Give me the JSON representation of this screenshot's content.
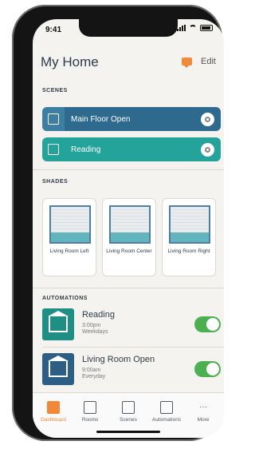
{
  "status": {
    "time": "9:41"
  },
  "header": {
    "title": "My Home",
    "edit": "Edit"
  },
  "scenes": {
    "label": "SCENES",
    "items": [
      {
        "label": "Main Floor Open",
        "color": "#2d6a8e",
        "icon": "window-icon"
      },
      {
        "label": "Reading",
        "color": "#24a39b",
        "icon": "book-icon"
      }
    ]
  },
  "shades": {
    "label": "SHADES",
    "items": [
      {
        "name": "Living Room Left"
      },
      {
        "name": "Living Room Center"
      },
      {
        "name": "Living Room Right"
      }
    ]
  },
  "automations": {
    "label": "AUTOMATIONS",
    "items": [
      {
        "name": "Reading",
        "time": "3:00pm",
        "days": "Weekdays",
        "tile_color": "#1f8f86",
        "enabled": true
      },
      {
        "name": "Living Room Open",
        "time": "9:00am",
        "days": "Everyday",
        "tile_color": "#2d5f86",
        "enabled": true
      }
    ]
  },
  "tabbar": {
    "tabs": [
      {
        "label": "Dashboard",
        "icon": "home-icon",
        "active": true
      },
      {
        "label": "Rooms",
        "icon": "grid-icon"
      },
      {
        "label": "Scenes",
        "icon": "play-icon"
      },
      {
        "label": "Automations",
        "icon": "calendar-icon"
      },
      {
        "label": "More",
        "icon": "more-icon"
      }
    ]
  }
}
